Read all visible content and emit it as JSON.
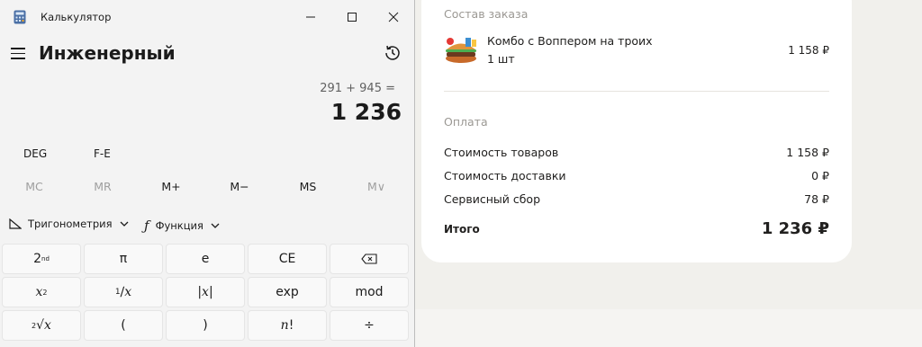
{
  "order": {
    "composition_title": "Состав заказа",
    "item": {
      "name": "Комбо с Воппером на троих",
      "qty": "1 шт",
      "price": "1 158 ₽",
      "image_icon": "burger-combo-icon"
    },
    "payment_title": "Оплата",
    "rows": [
      {
        "label": "Стоимость товаров",
        "value": "1 158 ₽"
      },
      {
        "label": "Стоимость доставки",
        "value": "0 ₽"
      },
      {
        "label": "Сервисный сбор",
        "value": "78 ₽"
      }
    ],
    "total_label": "Итого",
    "total_value": "1 236 ₽"
  },
  "calculator": {
    "window_title": "Калькулятор",
    "mode_title": "Инженерный",
    "expression": "291 + 945 =",
    "result": "1 236",
    "angle_mode": "DEG",
    "fe_label": "F-E",
    "memory": [
      "MC",
      "MR",
      "M+",
      "M−",
      "MS",
      "M∨"
    ],
    "trig_label": "Тригонометрия",
    "func_label": "Функция",
    "keys": [
      [
        "2nd",
        "π",
        "e",
        "CE",
        "⌫"
      ],
      [
        "x²",
        "¹∕x",
        "|x|",
        "exp",
        "mod"
      ],
      [
        "²√x",
        "(",
        ")",
        "n!",
        "÷"
      ]
    ]
  },
  "colors": {
    "disabled_text": "#9e9e9e",
    "accent_text": "#1b1b1b",
    "card_bg": "#ffffff",
    "page_bg": "#f1f0ec"
  }
}
